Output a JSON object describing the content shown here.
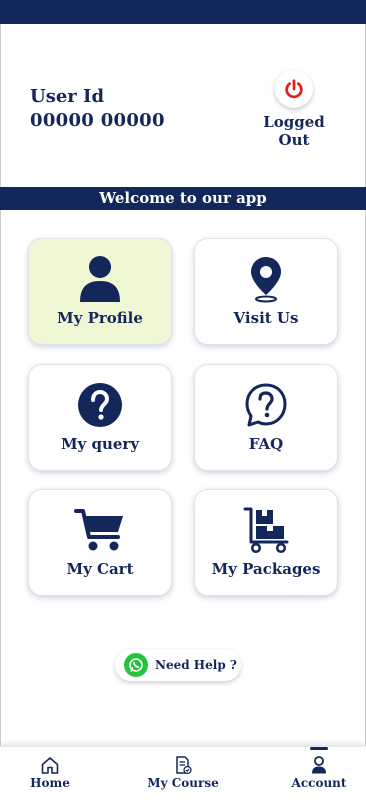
{
  "header": {
    "user_id_label": "User Id",
    "user_id_value": "00000 00000",
    "logout_label": "Logged Out",
    "logout_icon": "power-icon"
  },
  "welcome_text": "Welcome to our app",
  "tiles": [
    {
      "label": "My Profile",
      "icon": "user-icon",
      "active": true
    },
    {
      "label": "Visit Us",
      "icon": "location-pin-icon",
      "active": false
    },
    {
      "label": "My query",
      "icon": "question-circle-icon",
      "active": false
    },
    {
      "label": "FAQ",
      "icon": "question-bubble-icon",
      "active": false
    },
    {
      "label": "My Cart",
      "icon": "cart-icon",
      "active": false
    },
    {
      "label": "My Packages",
      "icon": "package-trolley-icon",
      "active": false
    }
  ],
  "help": {
    "label": "Need Help ?",
    "icon": "whatsapp-icon"
  },
  "bottom_nav": [
    {
      "label": "Home",
      "icon": "home-icon",
      "active": false
    },
    {
      "label": "My Course",
      "icon": "course-document-icon",
      "active": false
    },
    {
      "label": "Account",
      "icon": "account-icon",
      "active": true
    }
  ],
  "colors": {
    "primary": "#14275a",
    "active_tile_bg": "#eff7d5",
    "logout_red": "#e02020",
    "whatsapp_green": "#25c23f"
  }
}
